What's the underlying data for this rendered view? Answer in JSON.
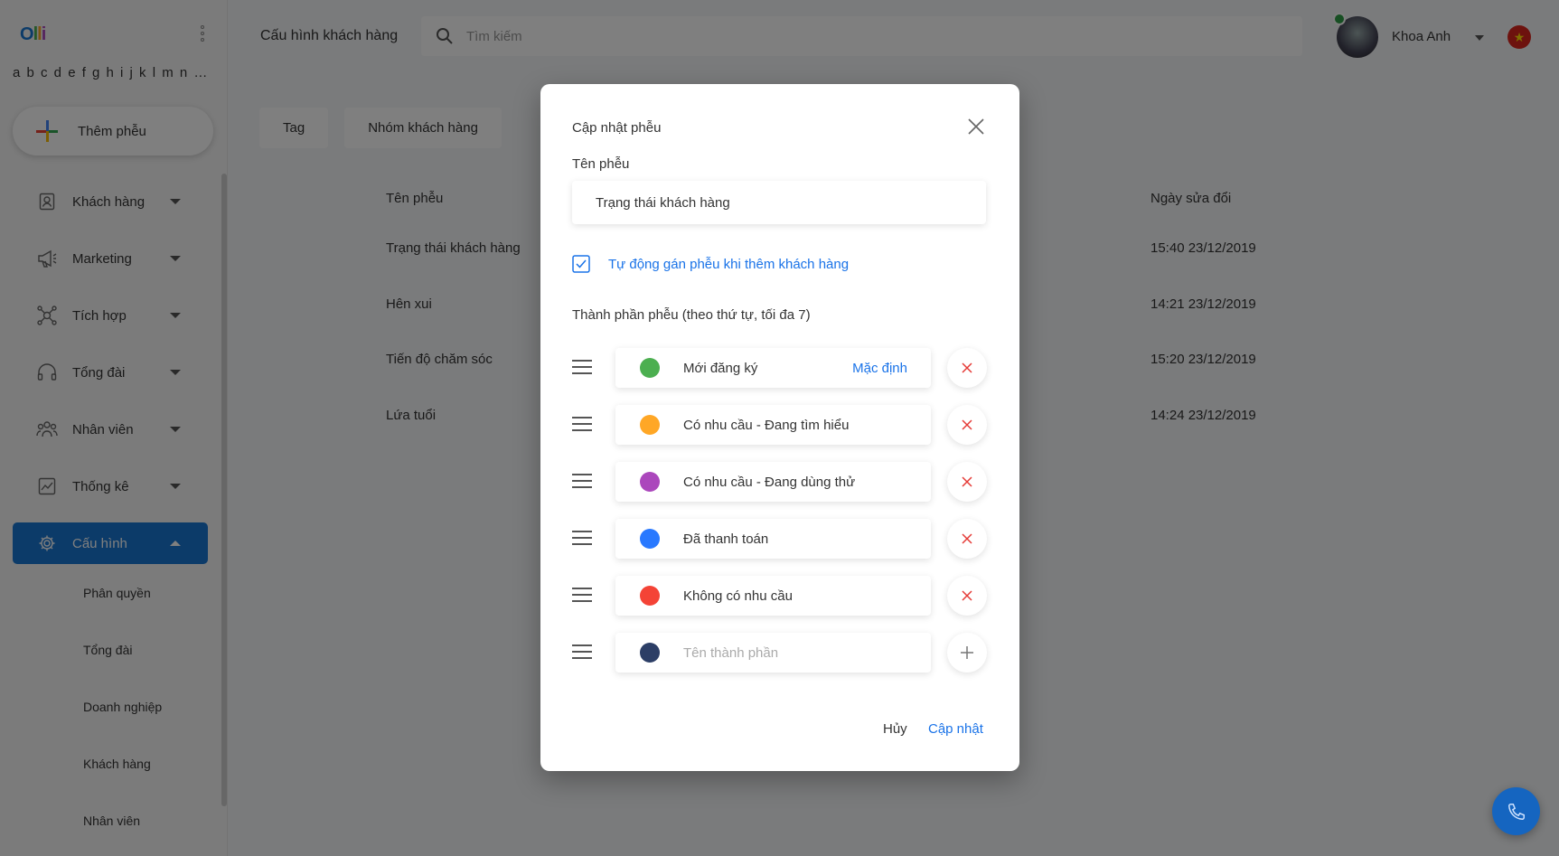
{
  "app": {
    "logo_text": "Olli",
    "alphabet_label": "a b c d e f g h i j k l m n o p q r s t u v w x y z"
  },
  "sidebar": {
    "add_button_label": "Thêm phễu",
    "items": [
      {
        "label": "Khách hàng",
        "icon": "contact-icon"
      },
      {
        "label": "Marketing",
        "icon": "megaphone-icon"
      },
      {
        "label": "Tích hợp",
        "icon": "integration-icon"
      },
      {
        "label": "Tổng đài",
        "icon": "headset-icon"
      },
      {
        "label": "Nhân viên",
        "icon": "team-icon"
      },
      {
        "label": "Thống kê",
        "icon": "chart-icon"
      },
      {
        "label": "Cấu hình",
        "icon": "gear-icon",
        "active": true
      }
    ],
    "subitems": [
      "Phân quyền",
      "Tổng đài",
      "Doanh nghiệp",
      "Khách hàng",
      "Nhân viên"
    ]
  },
  "header": {
    "page_title": "Cấu hình khách hàng",
    "search_placeholder": "Tìm kiếm",
    "user_name": "Khoa Anh",
    "language_flag_icon": "vietnam-flag-icon"
  },
  "content": {
    "tabs": [
      "Tag",
      "Nhóm khách hàng"
    ],
    "columns": {
      "name": "Tên phễu",
      "modified": "Ngày sửa đổi"
    },
    "rows": [
      {
        "name": "Trạng thái khách hàng",
        "modified": "15:40 23/12/2019"
      },
      {
        "name": "Hên xui",
        "modified": "14:21 23/12/2019"
      },
      {
        "name": "Tiến độ chăm sóc",
        "modified": "15:20 23/12/2019"
      },
      {
        "name": "Lứa tuổi",
        "modified": "14:24 23/12/2019"
      }
    ]
  },
  "modal": {
    "title": "Cập nhật phễu",
    "name_label": "Tên phễu",
    "name_value": "Trạng thái khách hàng",
    "auto_assign_label": "Tự động gán phễu khi thêm khách hàng",
    "auto_assign_checked": true,
    "stages_label": "Thành phần phễu (theo thứ tự, tối đa 7)",
    "default_label": "Mặc định",
    "stages": [
      {
        "name": "Mới đăng ký",
        "color": "#4caf50",
        "is_default": true
      },
      {
        "name": "Có nhu cầu - Đang tìm hiểu",
        "color": "#ffa726"
      },
      {
        "name": "Có nhu cầu - Đang dùng thử",
        "color": "#ab47bc"
      },
      {
        "name": "Đã thanh toán",
        "color": "#2979ff"
      },
      {
        "name": "Không có nhu cầu",
        "color": "#f44336"
      }
    ],
    "new_stage_placeholder": "Tên thành phần",
    "new_stage_color": "#2c3e66",
    "cancel_label": "Hủy",
    "submit_label": "Cập nhật"
  }
}
